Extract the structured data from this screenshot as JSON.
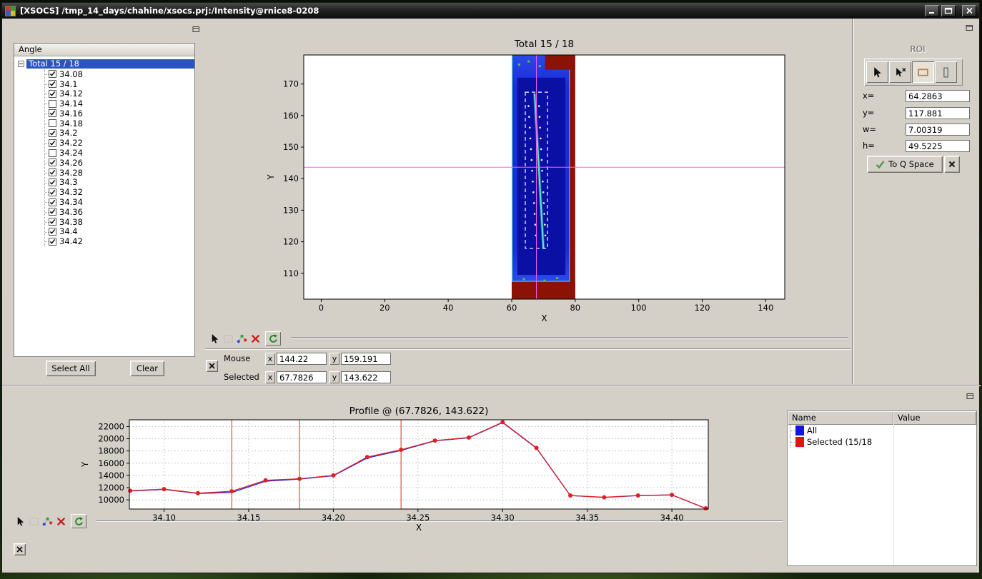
{
  "window": {
    "title": "[XSOCS] /tmp_14_days/chahine/xsocs.prj:/Intensity@rnice8-0208",
    "controls": [
      "minimize",
      "maximize",
      "close"
    ]
  },
  "angle_panel": {
    "header": "Angle",
    "root_label": "Total 15 / 18",
    "items": [
      {
        "label": "34.08",
        "checked": true
      },
      {
        "label": "34.1",
        "checked": true
      },
      {
        "label": "34.12",
        "checked": true
      },
      {
        "label": "34.14",
        "checked": false
      },
      {
        "label": "34.16",
        "checked": true
      },
      {
        "label": "34.18",
        "checked": false
      },
      {
        "label": "34.2",
        "checked": true
      },
      {
        "label": "34.22",
        "checked": true
      },
      {
        "label": "34.24",
        "checked": false
      },
      {
        "label": "34.26",
        "checked": true
      },
      {
        "label": "34.28",
        "checked": true
      },
      {
        "label": "34.3",
        "checked": true
      },
      {
        "label": "34.32",
        "checked": true
      },
      {
        "label": "34.34",
        "checked": true
      },
      {
        "label": "34.36",
        "checked": true
      },
      {
        "label": "34.38",
        "checked": true
      },
      {
        "label": "34.4",
        "checked": true
      },
      {
        "label": "34.42",
        "checked": true
      }
    ],
    "select_all_label": "Select All",
    "clear_label": "Clear"
  },
  "mouse_status": {
    "mouse_label": "Mouse",
    "selected_label": "Selected",
    "x_label": "x",
    "y_label": "y",
    "mouse_x": "144.22",
    "mouse_y": "159.191",
    "selected_x": "67.7826",
    "selected_y": "143.622"
  },
  "roi_panel": {
    "title": "ROI",
    "fields": [
      {
        "label": "x=",
        "value": "64.2863"
      },
      {
        "label": "y=",
        "value": "117.881"
      },
      {
        "label": "w=",
        "value": "7.00319"
      },
      {
        "label": "h=",
        "value": "49.5225"
      }
    ],
    "to_q_space_label": "To Q Space"
  },
  "legend_table": {
    "headers": [
      "Name",
      "Value"
    ],
    "rows": [
      {
        "name": "All",
        "color": "#1515e0"
      },
      {
        "name": "Selected (15/18",
        "color": "#e01515"
      }
    ]
  },
  "icons": {
    "plot_toolbar": [
      "pointer",
      "zoom-rect",
      "plot-style",
      "close",
      "refresh"
    ],
    "roi_tools": [
      "pointer",
      "pointer-draw",
      "rectangle-roi",
      "vertical-roi"
    ],
    "roi_active_tool": "rectangle-roi",
    "panel_corner": "undock"
  },
  "chart_data": [
    {
      "type": "heatmap",
      "title": "Total 15 / 18",
      "xlabel": "X",
      "ylabel": "Y",
      "x_ticks": [
        0,
        20,
        40,
        60,
        80,
        100,
        120,
        140
      ],
      "y_ticks": [
        110,
        120,
        130,
        140,
        150,
        160,
        170
      ],
      "x_range": [
        -5.5,
        146.0
      ],
      "y_range": [
        101.8,
        179.2
      ],
      "image": {
        "x0": 60,
        "x1": 80,
        "y0": 101.8,
        "y1": 179.2,
        "red_right_x": 78.3,
        "red_bottom_y": 107.3,
        "red_top_right": {
          "x0": 70.5,
          "y0": 174.5
        },
        "blue": "#1a2cd6",
        "blue_dark": "#0a10a4",
        "cyan_fringe": "#3fc8cf",
        "red": "#8c1205",
        "streak_color": "#5ce8c4",
        "streak": {
          "x_top": 67.2,
          "y_top": 167.0,
          "x_bot": 70.0,
          "y_bot": 117.8
        }
      },
      "crosshair": {
        "x": 67.7826,
        "y": 143.622,
        "color": "#ff5ced"
      },
      "roi": {
        "x": 64.2863,
        "y": 117.881,
        "w": 7.00319,
        "h": 49.5225,
        "color": "#ffffff"
      }
    },
    {
      "type": "line",
      "title": "Profile @ (67.7826, 143.622)",
      "xlabel": "X",
      "ylabel": "Y",
      "x_range": [
        34.0795,
        34.4215
      ],
      "y_range": [
        8500,
        23100
      ],
      "x_ticks": [
        34.1,
        34.15,
        34.2,
        34.25,
        34.3,
        34.35,
        34.4
      ],
      "y_ticks": [
        10000,
        12000,
        14000,
        16000,
        18000,
        20000,
        22000
      ],
      "grid": true,
      "x": [
        34.08,
        34.1,
        34.12,
        34.14,
        34.16,
        34.18,
        34.2,
        34.22,
        34.24,
        34.26,
        34.28,
        34.3,
        34.32,
        34.34,
        34.36,
        34.38,
        34.4,
        34.42
      ],
      "series": [
        {
          "name": "All",
          "color": "#2222ee",
          "marker": false,
          "values": [
            11450,
            11700,
            11050,
            11200,
            13050,
            13400,
            13950,
            16850,
            18100,
            19650,
            20150,
            22650,
            18450,
            10700,
            10400,
            10700,
            10800,
            8600
          ]
        },
        {
          "name": "Selected (15/18",
          "color": "#e02020",
          "marker": true,
          "values": [
            11500,
            11750,
            11100,
            11400,
            13200,
            13450,
            14000,
            17000,
            18200,
            19700,
            20200,
            22700,
            18500,
            10720,
            10420,
            10720,
            10820,
            8620
          ]
        }
      ],
      "excluded_x": [
        34.14,
        34.18,
        34.24
      ],
      "excluded_color": "#ee2222"
    }
  ]
}
